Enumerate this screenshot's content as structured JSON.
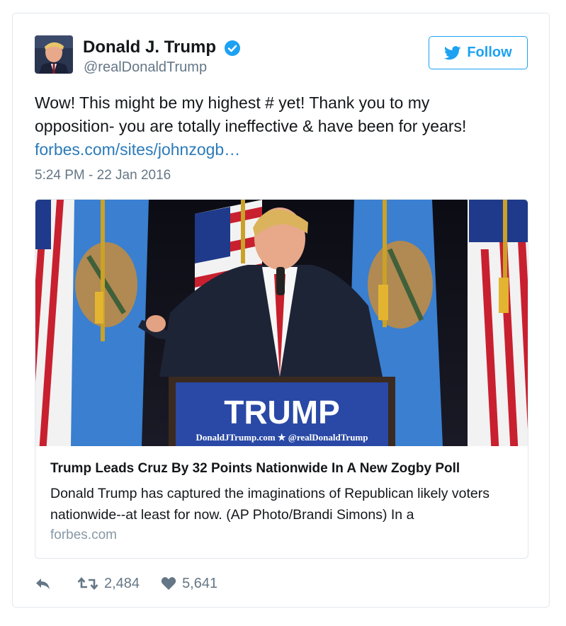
{
  "tweet": {
    "author_name": "Donald J. Trump",
    "author_handle": "@realDonaldTrump",
    "follow_label": "Follow",
    "text_line1": "Wow! This might be my highest # yet! Thank you to my",
    "text_line2": "opposition- you are totally ineffective & have been for years!",
    "link_text": "forbes.com/sites/johnzogb…",
    "timestamp": "5:24 PM - 22 Jan 2016"
  },
  "card": {
    "podium_sign": "TRUMP",
    "podium_subtext": "DonaldJTrump.com ★ @realDonaldTrump",
    "title": "Trump Leads Cruz By 32 Points Nationwide In A New Zogby Poll",
    "description": "Donald Trump has captured the imaginations of Republican likely voters nationwide--at least for now. (AP Photo/Brandi Simons) In a",
    "domain": "forbes.com"
  },
  "actions": {
    "reply_icon": "reply-icon",
    "retweet_icon": "retweet-icon",
    "retweet_count": "2,484",
    "like_icon": "heart-icon",
    "like_count": "5,641"
  },
  "colors": {
    "accent": "#1da1f2",
    "link": "#2b7bb9",
    "muted": "#657786",
    "border": "#e1e8ed"
  }
}
